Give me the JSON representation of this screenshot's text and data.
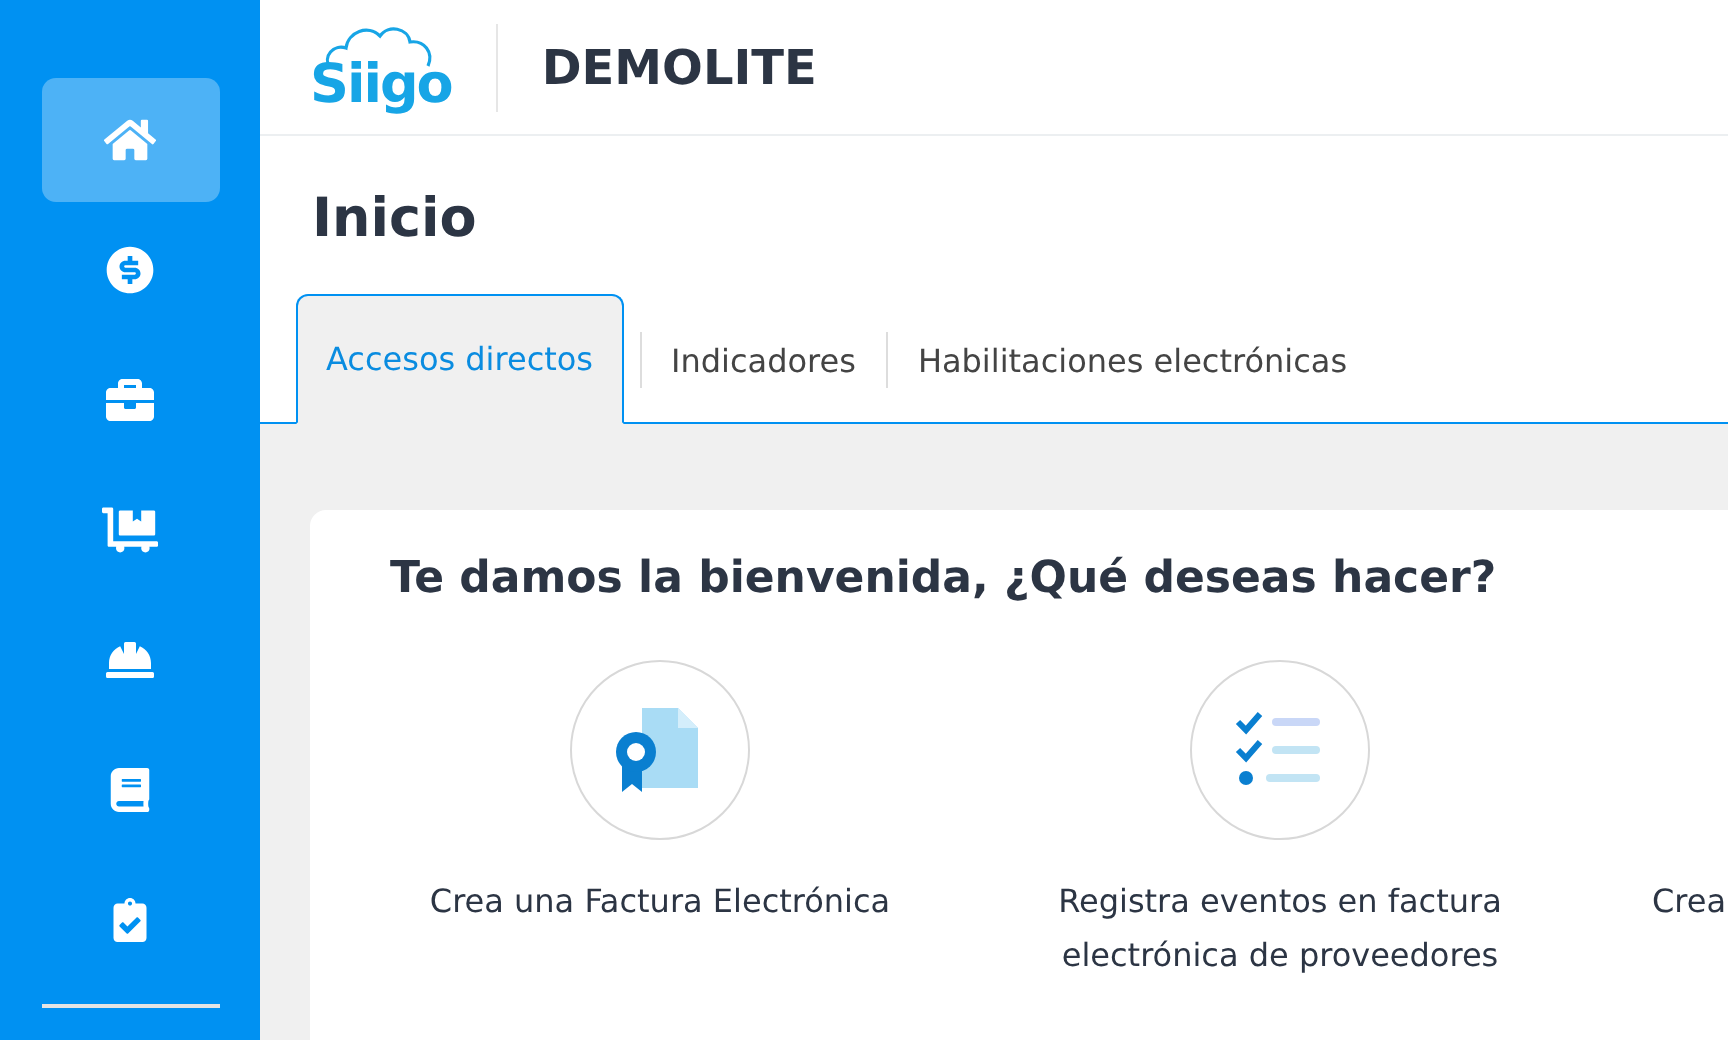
{
  "sidebar": {
    "items": [
      {
        "kind": "home",
        "selected": true
      },
      {
        "kind": "money",
        "selected": false
      },
      {
        "kind": "briefcase",
        "selected": false
      },
      {
        "kind": "dolly",
        "selected": false
      },
      {
        "kind": "worker",
        "selected": false
      },
      {
        "kind": "book",
        "selected": false
      },
      {
        "kind": "clipboard",
        "selected": false
      }
    ]
  },
  "header": {
    "logo": "Siigo",
    "company": "DEMOLITE"
  },
  "page_title": "Inicio",
  "tabs": [
    {
      "label": "Accesos directos",
      "selected": true
    },
    {
      "label": "Indicadores",
      "selected": false
    },
    {
      "label": "Habilitaciones electrónicas",
      "selected": false
    }
  ],
  "welcome": {
    "heading": "Te damos la bienvenida, ¿Qué deseas hacer?",
    "shortcuts": [
      {
        "kind": "certificate",
        "label": "Crea una Factura Electrónica"
      },
      {
        "kind": "checklist",
        "label": "Registra eventos en factura electrónica de proveedores"
      },
      {
        "kind": "text",
        "label": "Crea"
      }
    ]
  }
}
